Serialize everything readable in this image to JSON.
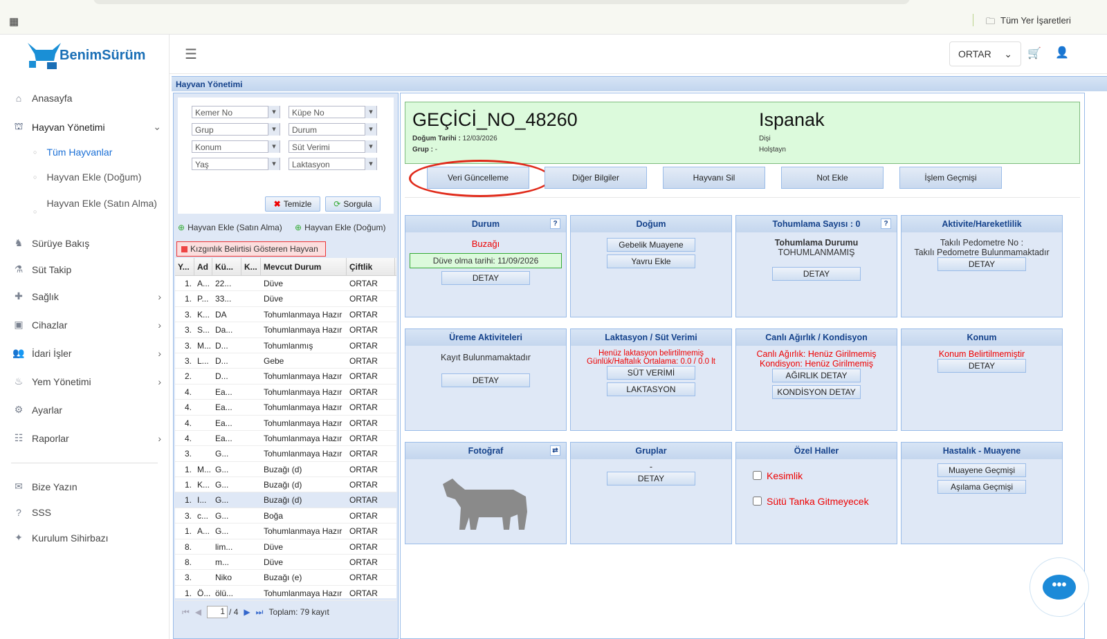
{
  "browser": {
    "bookmarks": "Tüm Yer İşaretleri"
  },
  "brand": {
    "name": "BenimSürüm"
  },
  "header": {
    "farm": "ORTAR"
  },
  "sidebar": {
    "items": [
      {
        "label": "Anasayfa",
        "icon": "home-icon"
      },
      {
        "label": "Hayvan Yönetimi",
        "icon": "barn-icon"
      },
      {
        "label": "Sürüye Bakış",
        "icon": "herd-icon"
      },
      {
        "label": "Süt Takip",
        "icon": "flask-icon"
      },
      {
        "label": "Sağlık",
        "icon": "health-icon"
      },
      {
        "label": "Cihazlar",
        "icon": "devices-icon"
      },
      {
        "label": "İdari İşler",
        "icon": "users-gear-icon"
      },
      {
        "label": "Yem Yönetimi",
        "icon": "feed-icon"
      },
      {
        "label": "Ayarlar",
        "icon": "gear-icon"
      },
      {
        "label": "Raporlar",
        "icon": "report-icon"
      },
      {
        "label": "Bize Yazın",
        "icon": "message-icon"
      },
      {
        "label": "SSS",
        "icon": "question-icon"
      },
      {
        "label": "Kurulum Sihirbazı",
        "icon": "wand-icon"
      }
    ],
    "sub": [
      "Tüm Hayvanlar",
      "Hayvan Ekle (Doğum)",
      "Hayvan Ekle (Satın Alma)"
    ]
  },
  "panel_title": "Hayvan Yönetimi",
  "filters": [
    "Kemer No",
    "Küpe No",
    "Grup",
    "Durum",
    "Konum",
    "Süt Verimi",
    "Yaş",
    "Laktasyon"
  ],
  "filter_buttons": {
    "clear": "Temizle",
    "query": "Sorgula"
  },
  "list_actions": {
    "add_purchase": "Hayvan Ekle (Satın Alma)",
    "add_birth": "Hayvan Ekle (Doğum)",
    "heat": "Kızgınlık Belirtisi Gösteren Hayvan"
  },
  "grid": {
    "headers": [
      "Y...",
      "Ad",
      "Kü...",
      "K...",
      "Mevcut Durum",
      "Çiftlik"
    ],
    "rows": [
      [
        "1.",
        "A...",
        "22...",
        "",
        "Düve",
        "ORTAR"
      ],
      [
        "1.",
        "P...",
        "33...",
        "",
        "Düve",
        "ORTAR"
      ],
      [
        "3.",
        "K...",
        "DA",
        "",
        "Tohumlanmaya Hazır",
        "ORTAR"
      ],
      [
        "3.",
        "S...",
        "Da...",
        "",
        "Tohumlanmaya Hazır",
        "ORTAR"
      ],
      [
        "3.",
        "M...",
        "D...",
        "",
        "Tohumlanmış",
        "ORTAR"
      ],
      [
        "3.",
        "L...",
        "D...",
        "",
        "Gebe",
        "ORTAR"
      ],
      [
        "2.",
        "",
        "D...",
        "",
        "Tohumlanmaya Hazır",
        "ORTAR"
      ],
      [
        "4.",
        "",
        "Ea...",
        "",
        "Tohumlanmaya Hazır",
        "ORTAR"
      ],
      [
        "4.",
        "",
        "Ea...",
        "",
        "Tohumlanmaya Hazır",
        "ORTAR"
      ],
      [
        "4.",
        "",
        "Ea...",
        "",
        "Tohumlanmaya Hazır",
        "ORTAR"
      ],
      [
        "4.",
        "",
        "Ea...",
        "",
        "Tohumlanmaya Hazır",
        "ORTAR"
      ],
      [
        "3.",
        "",
        "G...",
        "",
        "Tohumlanmaya Hazır",
        "ORTAR"
      ],
      [
        "1.",
        "M...",
        "G...",
        "",
        "Buzağı (d)",
        "ORTAR"
      ],
      [
        "1.",
        "K...",
        "G...",
        "",
        "Buzağı (d)",
        "ORTAR"
      ],
      [
        "1.",
        "I...",
        "G...",
        "",
        "Buzağı (d)",
        "ORTAR"
      ],
      [
        "3.",
        "c...",
        "G...",
        "",
        "Boğa",
        "ORTAR"
      ],
      [
        "1.",
        "A...",
        "G...",
        "",
        "Tohumlanmaya Hazır",
        "ORTAR"
      ],
      [
        "8.",
        "",
        "lim...",
        "",
        "Düve",
        "ORTAR"
      ],
      [
        "8.",
        "",
        "m...",
        "",
        "Düve",
        "ORTAR"
      ],
      [
        "3.",
        "",
        "Niko",
        "",
        "Buzağı (e)",
        "ORTAR"
      ],
      [
        "1.",
        "Ö...",
        "ölü...",
        "",
        "Tohumlanmaya Hazır",
        "ORTAR"
      ]
    ],
    "selected_row": 14
  },
  "pager": {
    "page": "1",
    "of": "/ 4",
    "total": "Toplam: 79 kayıt"
  },
  "animal": {
    "id": "GEÇİCİ_NO_48260",
    "birth_label": "Doğum Tarihi :",
    "birth": "12/03/2026",
    "group_label": "Grup :",
    "group": "-",
    "name": "Ispanak",
    "sex": "Dişi",
    "breed": "Holştayn"
  },
  "actions": [
    "Veri Güncelleme",
    "Diğer Bilgiler",
    "Hayvanı Sil",
    "Not Ekle",
    "İşlem Geçmişi"
  ],
  "cards": {
    "durum": {
      "title": "Durum",
      "status": "Buzağı",
      "heifer": "Düve olma tarihi: 11/09/2026",
      "btn": "DETAY"
    },
    "dogum": {
      "title": "Doğum",
      "btn1": "Gebelik Muayene",
      "btn2": "Yavru Ekle"
    },
    "tohum": {
      "title": "Tohumlama Sayısı : 0",
      "label": "Tohumlama Durumu",
      "value": "TOHUMLANMAMIŞ",
      "btn": "DETAY"
    },
    "aktivite": {
      "title": "Aktivite/Hareketlilik",
      "l1": "Takılı Pedometre No :",
      "l2": "Takılı Pedometre Bulunmamaktadır",
      "btn": "DETAY"
    },
    "ureme": {
      "title": "Üreme Aktiviteleri",
      "text": "Kayıt Bulunmamaktadır",
      "btn": "DETAY"
    },
    "laktasyon": {
      "title": "Laktasyon / Süt Verimi",
      "l1": "Henüz laktasyon belirtilmemiş",
      "l2": "Günlük/Haftalık Ortalama: 0.0 / 0.0 lt",
      "btn1": "SÜT VERİMİ",
      "btn2": "LAKTASYON"
    },
    "agirlik": {
      "title": "Canlı Ağırlık / Kondisyon",
      "l1": "Canlı Ağırlık: Henüz Girilmemiş",
      "l2": "Kondisyon: Henüz Girilmemiş",
      "btn1": "AĞIRLIK DETAY",
      "btn2": "KONDİSYON DETAY"
    },
    "konum": {
      "title": "Konum",
      "text": "Konum Belirtilmemiştir",
      "btn": "DETAY"
    },
    "foto": {
      "title": "Fotoğraf"
    },
    "gruplar": {
      "title": "Gruplar",
      "text": "-",
      "btn": "DETAY"
    },
    "ozel": {
      "title": "Özel Haller",
      "c1": "Kesimlik",
      "c2": "Sütü Tanka Gitmeyecek"
    },
    "hastalik": {
      "title": "Hastalık - Muayene",
      "btn1": "Muayene Geçmişi",
      "btn2": "Aşılama Geçmişi"
    }
  },
  "help": "?"
}
